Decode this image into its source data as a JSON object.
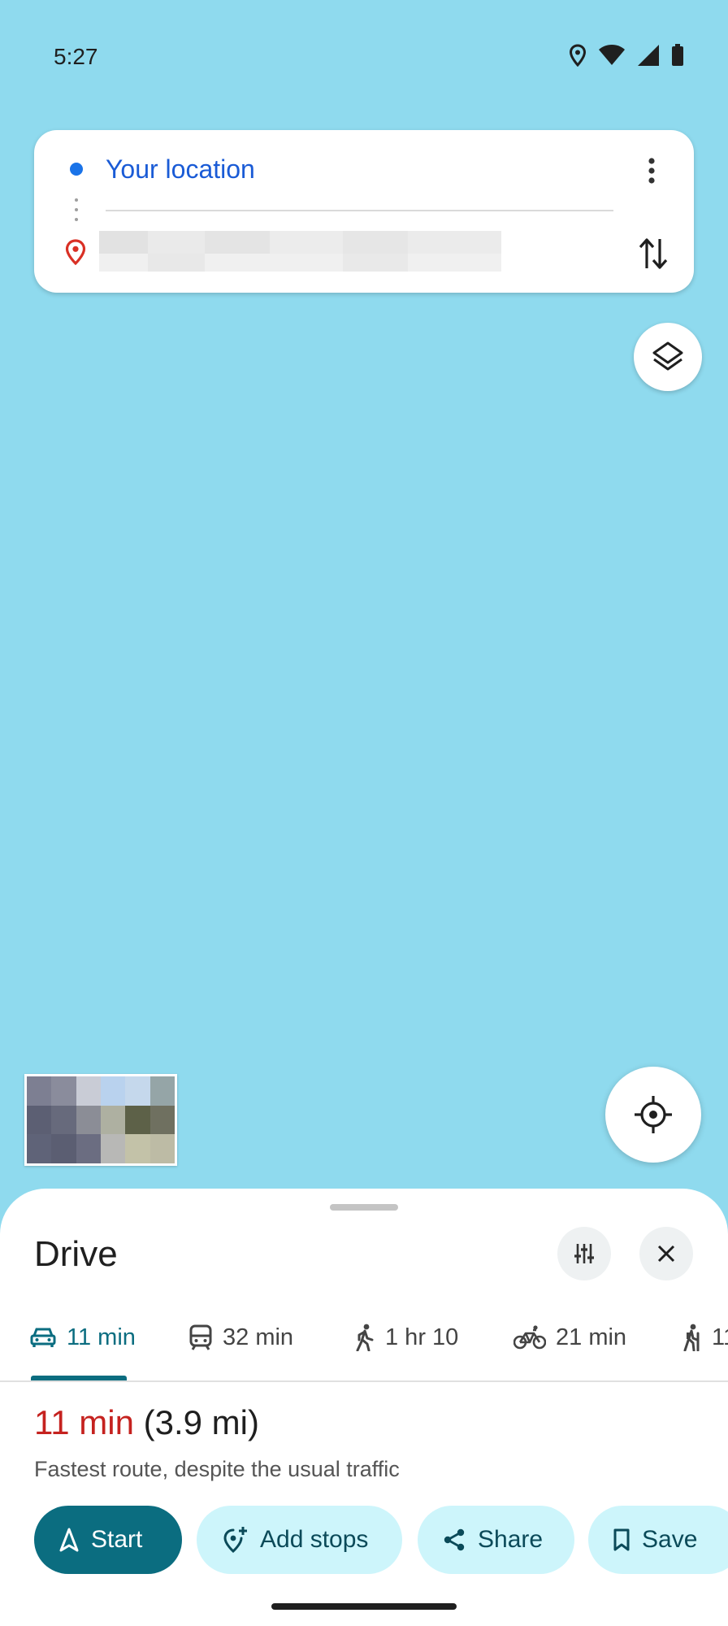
{
  "status_bar": {
    "time": "5:27",
    "icons": [
      "location-icon",
      "wifi-icon",
      "cellular-icon",
      "battery-icon"
    ]
  },
  "directions": {
    "origin": "Your location",
    "destination": "",
    "menu_icon": "more-vert-icon",
    "swap_icon": "swap-vertical-icon"
  },
  "map": {
    "layers_icon": "layers-icon",
    "locate_icon": "my-location-icon",
    "background_color": "#8fdaee"
  },
  "sheet": {
    "title": "Drive",
    "options_icon": "tune-icon",
    "close_icon": "close-icon",
    "tabs": [
      {
        "icon": "car-icon",
        "label": "11 min",
        "active": true
      },
      {
        "icon": "transit-icon",
        "label": "32 min",
        "active": false
      },
      {
        "icon": "walk-icon",
        "label": "1 hr 10",
        "active": false
      },
      {
        "icon": "bike-icon",
        "label": "21 min",
        "active": false
      },
      {
        "icon": "hiking-icon",
        "label": "11",
        "active": false
      }
    ],
    "route": {
      "duration": "11 min",
      "distance": "(3.9 mi)",
      "description": "Fastest route, despite the usual traffic"
    },
    "actions": [
      {
        "icon": "navigation-icon",
        "label": "Start"
      },
      {
        "icon": "add-location-icon",
        "label": "Add stops"
      },
      {
        "icon": "share-icon",
        "label": "Share"
      },
      {
        "icon": "bookmark-icon",
        "label": "Save"
      }
    ]
  },
  "colors": {
    "accent": "#0b6d80",
    "duration_red": "#c5221f",
    "origin_blue": "#1a5bd6",
    "chip_secondary": "#cdf5fb"
  }
}
